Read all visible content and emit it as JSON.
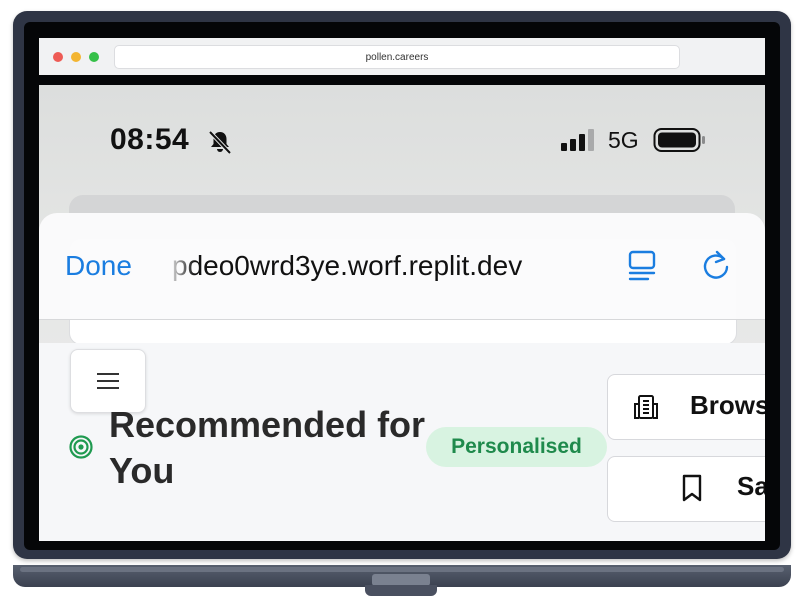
{
  "browser": {
    "url": "pollen.careers"
  },
  "status_bar": {
    "time": "08:54",
    "network": "5G",
    "icons": [
      "bell-slash-icon",
      "signal-icon",
      "battery-icon"
    ]
  },
  "safari": {
    "done_label": "Done",
    "url_display": "pdeo0wrd3ye.worf.replit.dev",
    "icons": [
      "reader-icon",
      "reload-icon"
    ],
    "accent": "#1a7de0"
  },
  "main": {
    "menu_icon": "hamburger-icon",
    "section_icon": "target-icon",
    "section_title": "Recommended for You",
    "badge": "Personalised",
    "badge_colors": {
      "bg": "#d8f3e1",
      "fg": "#1f8a4c"
    },
    "actions": [
      {
        "label": "Browse",
        "icon": "building-icon"
      },
      {
        "label": "Saved",
        "icon": "bookmark-icon"
      }
    ]
  }
}
